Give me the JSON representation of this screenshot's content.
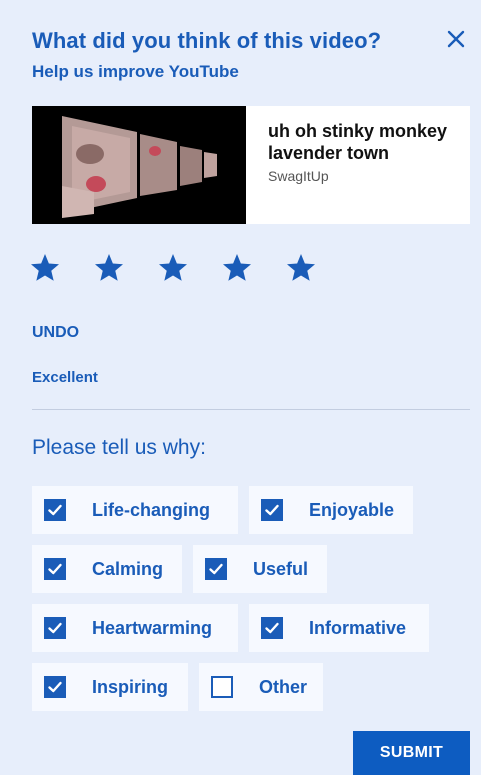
{
  "dialog": {
    "title": "What did you think of this video?",
    "subtitle": "Help us improve YouTube"
  },
  "video": {
    "title": "uh oh stinky monkey lavender town",
    "channel": "SwagItUp"
  },
  "rating": {
    "stars_filled": 5,
    "stars_total": 5,
    "undo_label": "UNDO",
    "label": "Excellent"
  },
  "reasons": {
    "heading": "Please tell us why:",
    "options": [
      {
        "label": "Life-changing",
        "checked": true
      },
      {
        "label": "Enjoyable",
        "checked": true
      },
      {
        "label": "Calming",
        "checked": true
      },
      {
        "label": "Useful",
        "checked": true
      },
      {
        "label": "Heartwarming",
        "checked": true
      },
      {
        "label": "Informative",
        "checked": true
      },
      {
        "label": "Inspiring",
        "checked": true
      },
      {
        "label": "Other",
        "checked": false
      }
    ]
  },
  "actions": {
    "submit_label": "SUBMIT"
  },
  "colors": {
    "accent": "#1a5cb8",
    "background": "#e7eefb",
    "submit": "#0d5cc1"
  }
}
